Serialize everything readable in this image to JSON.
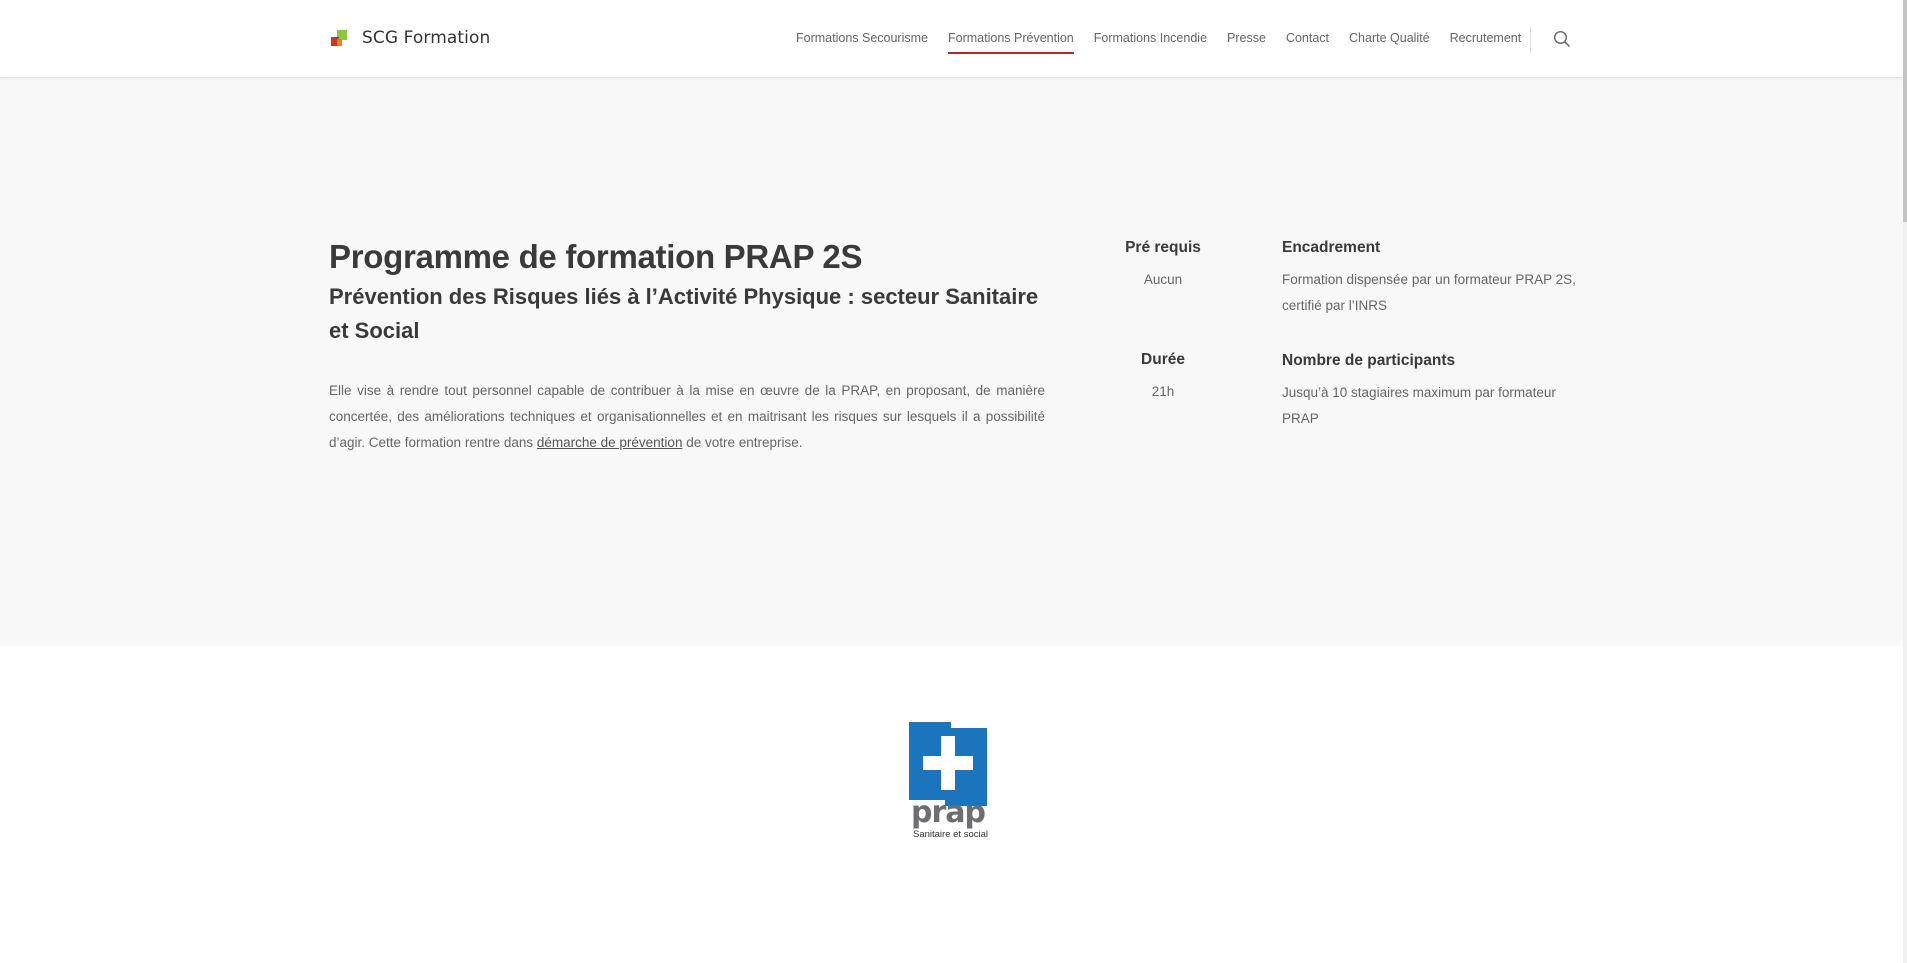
{
  "brand": {
    "name": "SCG Formation"
  },
  "nav": {
    "items": [
      {
        "label": "Formations Secourisme",
        "active": false
      },
      {
        "label": "Formations Prévention",
        "active": true
      },
      {
        "label": "Formations Incendie",
        "active": false
      },
      {
        "label": "Presse",
        "active": false
      },
      {
        "label": "Contact",
        "active": false
      },
      {
        "label": "Charte Qualité",
        "active": false
      },
      {
        "label": "Recrutement",
        "active": false
      }
    ],
    "search_icon": "search-icon",
    "accent_color": "#b5272d"
  },
  "hero": {
    "title": "Programme de formation PRAP 2S",
    "subtitle": "Prévention des Risques liés à l’Activité Physique : secteur Sanitaire et Social",
    "description_before_link": "Elle vise à rendre tout personnel capable de contribuer à la mise en œuvre de la PRAP, en proposant, de manière concertée, des améliorations techniques et organisationnelles et en maitrisant les risques sur lesquels il a possibilité d’agir. Cette formation rentre dans ",
    "description_link": "démarche de prévention",
    "description_after_link": " de  votre entreprise."
  },
  "info": {
    "prerequis": {
      "label": "Pré requis",
      "value": "Aucun"
    },
    "duree": {
      "label": "Durée",
      "value": "21h"
    },
    "encadrement": {
      "label": "Encadrement",
      "value": "Formation dispensée par un formateur PRAP 2S, certifié par l’INRS"
    },
    "participants": {
      "label": "Nombre de participants",
      "value": "Jusqu’à 10 stagiaires maximum par formateur PRAP"
    }
  },
  "prap_logo": {
    "word": "prap",
    "subtitle": "Sanitaire et social",
    "color": "#1c75bc"
  }
}
